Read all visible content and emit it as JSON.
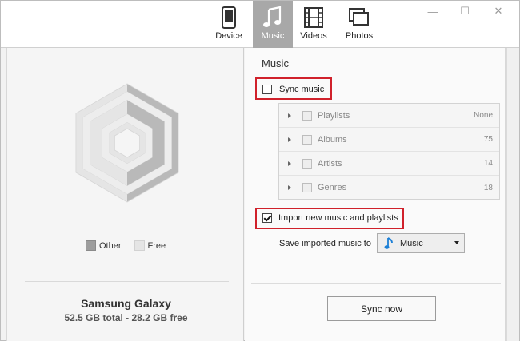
{
  "nav": {
    "tabs": [
      {
        "label": "Device",
        "icon": "phone-icon",
        "active": false
      },
      {
        "label": "Music",
        "icon": "music-note-icon",
        "active": true
      },
      {
        "label": "Videos",
        "icon": "film-strip-icon",
        "active": false
      },
      {
        "label": "Photos",
        "icon": "photos-icon",
        "active": false
      }
    ]
  },
  "window_controls": {
    "minimize": "—",
    "maximize": "☐",
    "close": "✕"
  },
  "storage": {
    "legend": [
      {
        "label": "Other",
        "color": "#9d9d9d"
      },
      {
        "label": "Free",
        "color": "#e5e5e5"
      }
    ],
    "other_fraction": 0.46,
    "device_name": "Samsung Galaxy",
    "summary": "52.5 GB total - 28.2 GB free"
  },
  "music": {
    "section_title": "Music",
    "sync_music": {
      "label": "Sync music",
      "checked": false
    },
    "categories": [
      {
        "label": "Playlists",
        "count": "None"
      },
      {
        "label": "Albums",
        "count": "75"
      },
      {
        "label": "Artists",
        "count": "14"
      },
      {
        "label": "Genres",
        "count": "18"
      }
    ],
    "import_new": {
      "label": "Import new music and playlists",
      "checked": true
    },
    "save_to": {
      "label": "Save imported music to",
      "value": "Music"
    },
    "sync_button": "Sync now"
  },
  "colors": {
    "accent": "#1b7fd6",
    "highlight": "#d0212b",
    "active_tab": "#a8a8a8"
  }
}
